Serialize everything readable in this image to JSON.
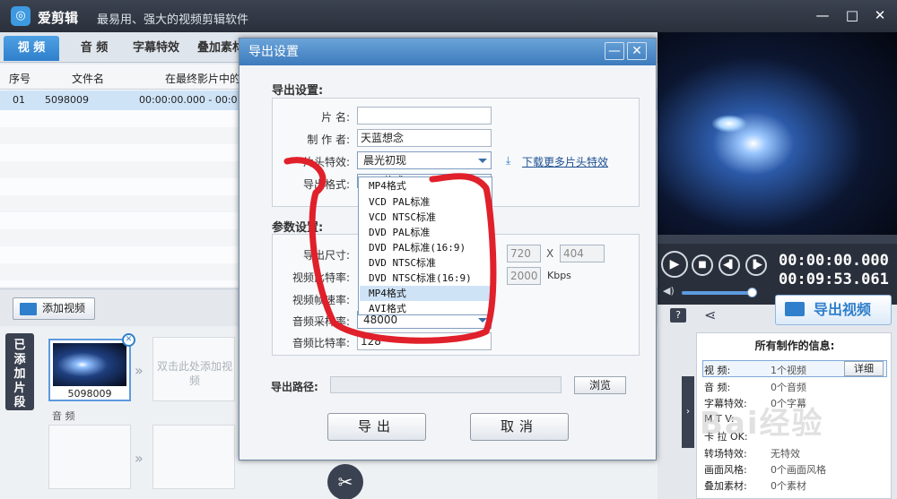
{
  "window": {
    "app_name": "爱剪辑",
    "slogan": "最易用、强大的视频剪辑软件",
    "logo_letter": "◎"
  },
  "tabs": [
    {
      "label": "视 频"
    },
    {
      "label": "音 频"
    },
    {
      "label": "字幕特效"
    },
    {
      "label": "叠加素材"
    }
  ],
  "list": {
    "headers": [
      "序号",
      "文件名",
      "在最终影片中的时"
    ],
    "rows": [
      {
        "index": "01",
        "name": "5098009",
        "time": "00:00:00.000 - 00:0"
      }
    ]
  },
  "add_video_label": "添加视频",
  "timeline": {
    "side_label": "已添加片段",
    "clip_name": "5098009",
    "placeholder": "双击此处添加视频",
    "audio_label": "音 频"
  },
  "player": {
    "current_time": "00:00:00.000",
    "total_time": "00:09:53.061"
  },
  "export_button_label": "导出视频",
  "info": {
    "title": "所有制作的信息:",
    "detail_label": "详细",
    "rows": [
      {
        "key": "视    频:",
        "value": "1个视频"
      },
      {
        "key": "音    频:",
        "value": "0个音频"
      },
      {
        "key": "字幕特效:",
        "value": "0个字幕"
      },
      {
        "key": "M   T   V:",
        "value": ""
      },
      {
        "key": "卡 拉 OK:",
        "value": ""
      },
      {
        "key": "转场特效:",
        "value": "无特效"
      },
      {
        "key": "画面风格:",
        "value": "0个画面风格"
      },
      {
        "key": "叠加素材:",
        "value": "0个素材"
      }
    ]
  },
  "dialog": {
    "title": "导出设置",
    "minimize": "—",
    "close": "✕",
    "section1": "导出设置:",
    "film_name_label": "片    名:",
    "film_name_value": "",
    "author_label": "制 作 者:",
    "author_value": "天蓝想念",
    "intro_effect_label": "片头特效:",
    "intro_effect_value": "晨光初现",
    "download_link": "下载更多片头特效",
    "format_label": "导出格式:",
    "format_value": "MP4格式",
    "format_options": [
      "VCD PAL标准",
      "VCD NTSC标准",
      "DVD PAL标准",
      "DVD PAL标准(16:9)",
      "DVD NTSC标准",
      "DVD NTSC标准(16:9)",
      "MP4格式",
      "AVI格式"
    ],
    "selected_option_index": 6,
    "section2": "参数设置:",
    "size_label": "导出尺寸:",
    "width_value": "720",
    "size_x": "X",
    "height_value": "404",
    "bitrate_label": "视频比特率:",
    "bitrate_value": "2000",
    "bitrate_unit": "Kbps",
    "framerate_label": "视频帧速率:",
    "audio_rate_label": "音频采样率:",
    "audio_rate_value": "48000",
    "audio_bitrate_label": "音频比特率:",
    "audio_bitrate_value": "128",
    "path_label": "导出路径:",
    "browse_label": "浏览",
    "export_label": "导出",
    "cancel_label": "取消"
  },
  "watermark": "Bai经验",
  "colors": {
    "accent": "#2f7fcc",
    "annotation": "#e0202a",
    "titlebar": "#2a303b"
  }
}
